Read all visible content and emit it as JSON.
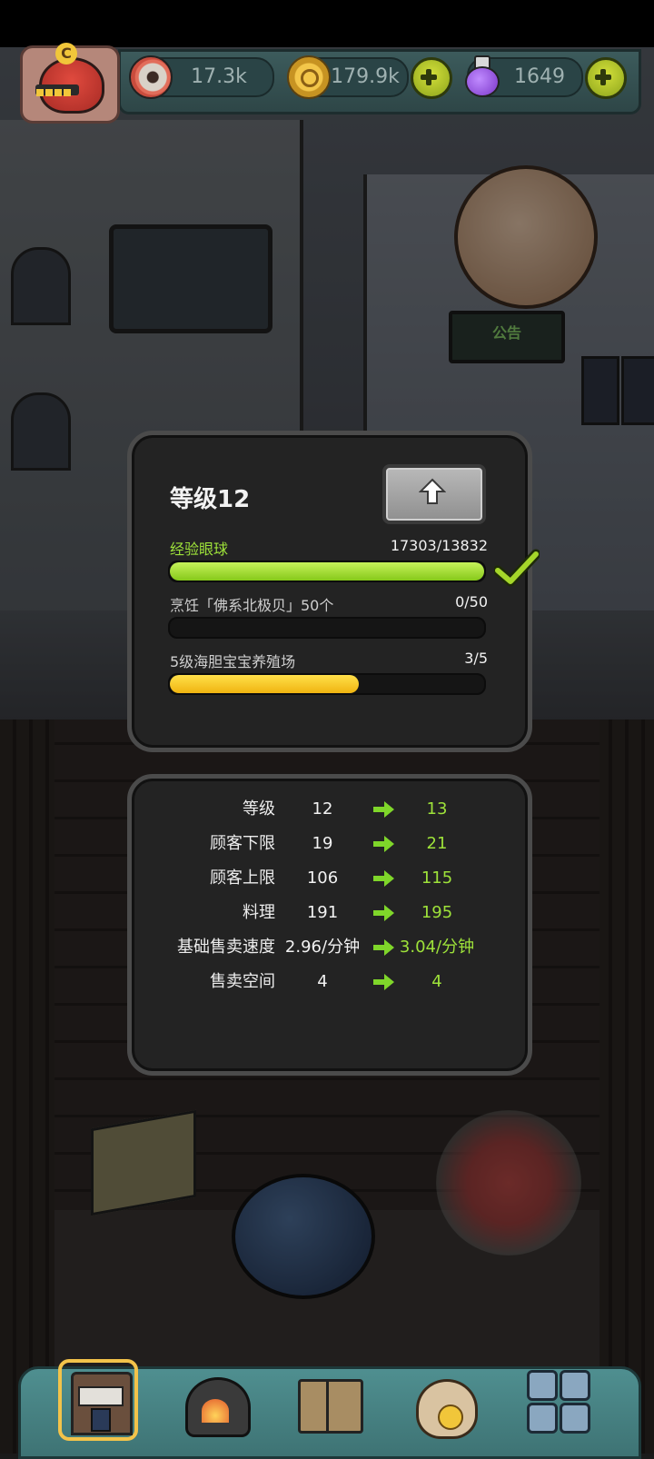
{
  "hud": {
    "avatar_letter": "C",
    "eyeballs": "17.3k",
    "coins": "179.9k",
    "potions": "1649"
  },
  "scene": {
    "notice_board": "公告"
  },
  "level_panel": {
    "title": "等级12",
    "requirements": [
      {
        "label": "经验眼球",
        "value": "17303/13832",
        "progress": 1.0,
        "color": "#9ee23a",
        "completed": true
      },
      {
        "label": "烹饪「佛系北极贝」50个",
        "value": "0/50",
        "progress": 0.0,
        "color": "#cfcfcf",
        "completed": false
      },
      {
        "label": "5级海胆宝宝养殖场",
        "value": "3/5",
        "progress": 0.6,
        "color": "#cfcfcf",
        "completed": false
      }
    ]
  },
  "stats_panel": {
    "rows": [
      {
        "label": "等级",
        "current": "12",
        "next": "13"
      },
      {
        "label": "顾客下限",
        "current": "19",
        "next": "21"
      },
      {
        "label": "顾客上限",
        "current": "106",
        "next": "115"
      },
      {
        "label": "料理",
        "current": "191",
        "next": "195"
      },
      {
        "label": "基础售卖速度",
        "current": "2.96/分钟",
        "next": "3.04/分钟"
      },
      {
        "label": "售卖空间",
        "current": "4",
        "next": "4"
      }
    ]
  },
  "colors": {
    "accent_green": "#9ee23a",
    "progress_yellow": "#f5c518",
    "panel_bg": "#232323"
  },
  "bottom_nav": {
    "items": [
      "shop-icon",
      "kitchen-icon",
      "recipe-book-icon",
      "bag-icon",
      "grid-menu-icon"
    ],
    "active": "shop-icon"
  }
}
